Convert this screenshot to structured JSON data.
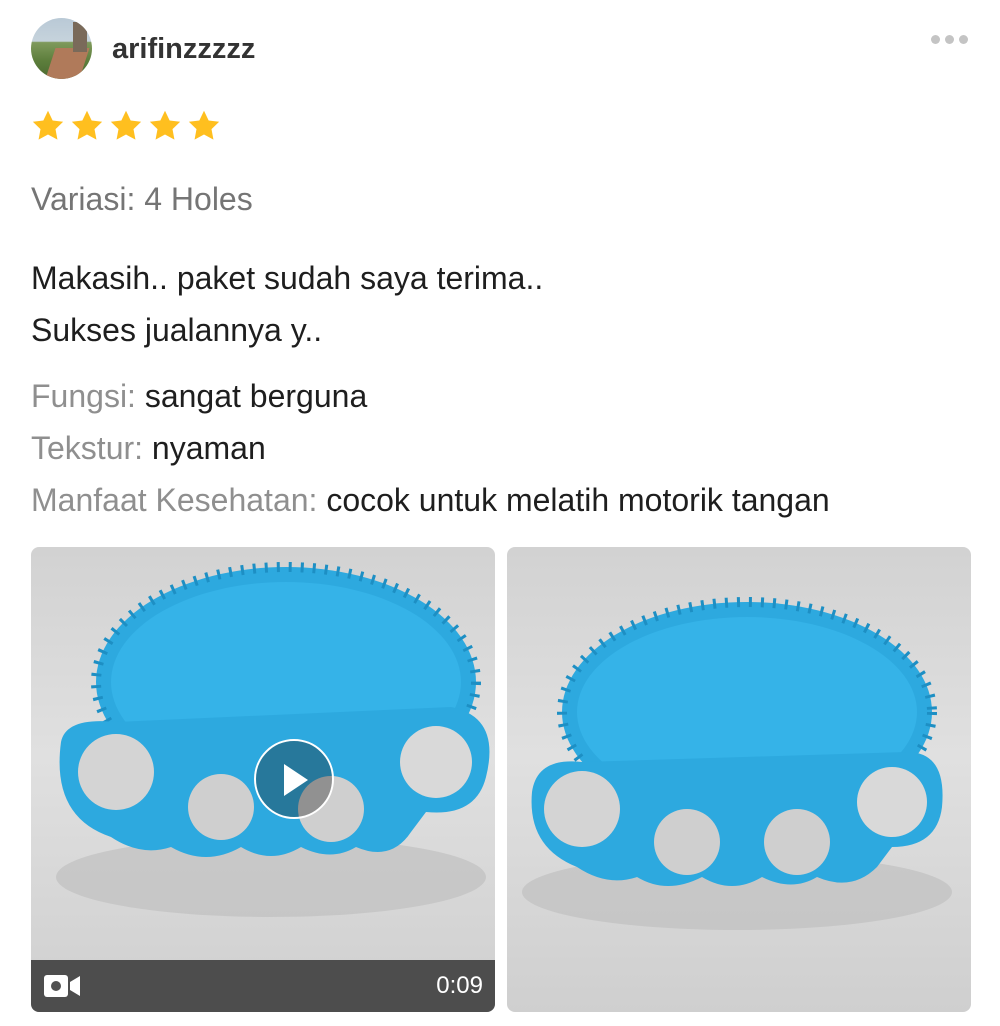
{
  "review": {
    "username": "arifinzzzzz",
    "rating": 5,
    "rating_max": 5,
    "variation": "Variasi: 4 Holes",
    "text_lines": [
      "Makasih.. paket sudah saya terima..",
      "Sukses jualannya y.."
    ],
    "attributes": [
      {
        "label": "Fungsi:",
        "value": "sangat berguna"
      },
      {
        "label": "Tekstur:",
        "value": "nyaman"
      },
      {
        "label": "Manfaat Kesehatan:",
        "value": "cocok untuk melatih motorik tangan"
      }
    ]
  },
  "media": {
    "video": {
      "duration": "0:09"
    }
  },
  "icons": {
    "star": "star-icon",
    "more": "more-icon",
    "play": "play-icon",
    "video": "video-camera-icon"
  },
  "colors": {
    "star": "#FFBF1F",
    "product_blue": "#2DA9DF"
  }
}
